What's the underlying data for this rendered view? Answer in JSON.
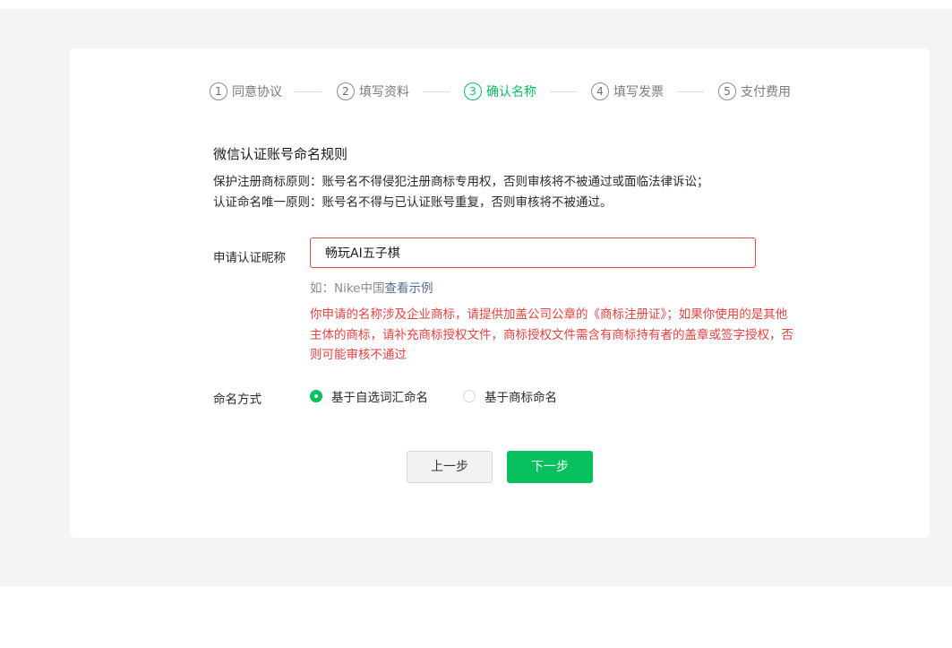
{
  "steps": [
    {
      "num": "1",
      "label": "同意协议",
      "active": false
    },
    {
      "num": "2",
      "label": "填写资料",
      "active": false
    },
    {
      "num": "3",
      "label": "确认名称",
      "active": true
    },
    {
      "num": "4",
      "label": "填写发票",
      "active": false
    },
    {
      "num": "5",
      "label": "支付费用",
      "active": false
    }
  ],
  "rules": {
    "title": "微信认证账号命名规则",
    "line1": "保护注册商标原则：账号名不得侵犯注册商标专用权，否则审核将不被通过或面临法律诉讼；",
    "line2": "认证命名唯一原则：账号名不得与已认证账号重复，否则审核将不被通过。"
  },
  "form": {
    "nickname_label": "申请认证昵称",
    "nickname_value": "畅玩AI五子棋",
    "hint_prefix": "如：Nike中国",
    "hint_link": "查看示例",
    "error": "你申请的名称涉及企业商标，请提供加盖公司公章的《商标注册证》；如果你使用的是其他主体的商标，请补充商标授权文件，商标授权文件需含有商标持有者的盖章或签字授权，否则可能审核不通过",
    "mode_label": "命名方式",
    "mode_options": [
      {
        "label": "基于自选词汇命名",
        "checked": true
      },
      {
        "label": "基于商标命名",
        "checked": false
      }
    ]
  },
  "buttons": {
    "prev": "上一步",
    "next": "下一步"
  },
  "colors": {
    "accent": "#07c160",
    "error": "#e64340",
    "link": "#576b95"
  }
}
